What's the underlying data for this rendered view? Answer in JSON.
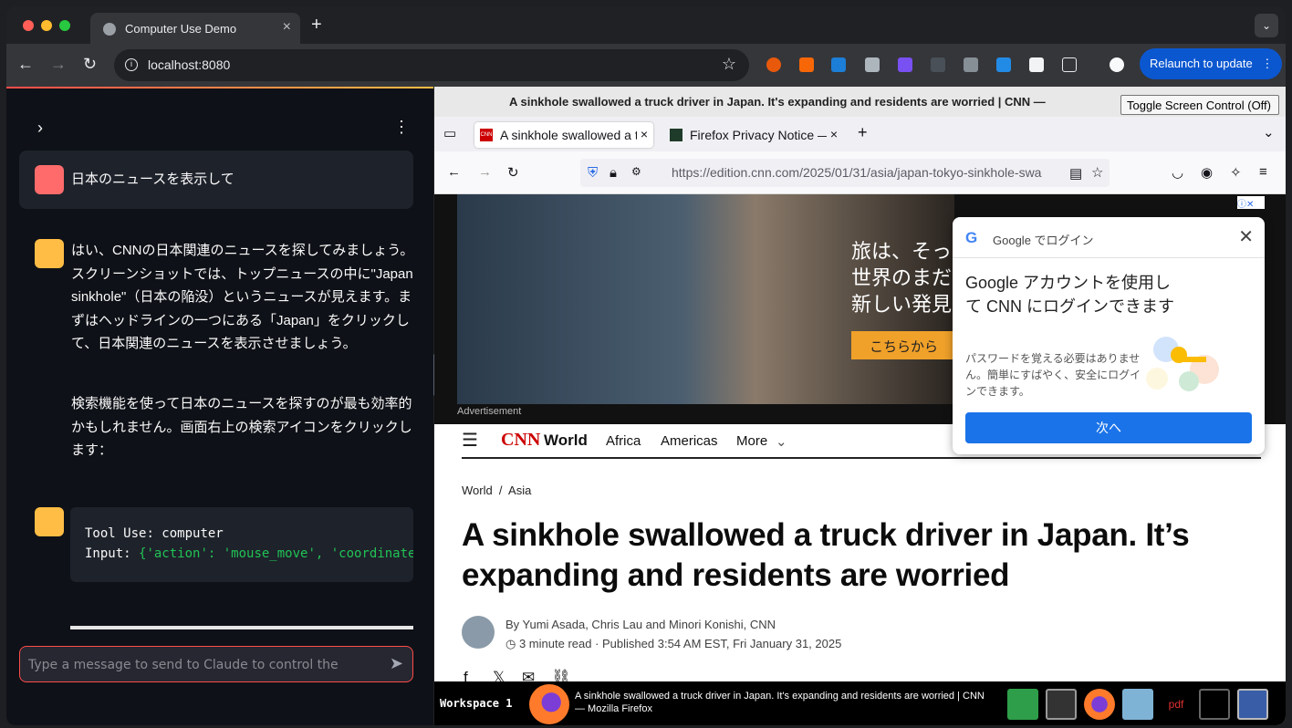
{
  "browser": {
    "tab_title": "Computer Use Demo",
    "url": "localhost:8080",
    "relaunch_label": "Relaunch to update"
  },
  "sidebar": {
    "user_message": "日本のニュースを表示して",
    "assistant_para1": "はい、CNNの日本関連のニュースを探してみましょう。スクリーンショットでは、トップニュースの中に\"Japan sinkhole\"（日本の陥没）というニュースが見えます。まずはヘッドラインの一つにある「Japan」をクリックして、日本関連のニュースを表示させましょう。",
    "assistant_para2": "検索機能を使って日本のニュースを探すのが最も効率的かもしれません。画面右上の検索アイコンをクリックします：",
    "tool_line1_key": "Tool Use",
    "tool_line1_val": "computer",
    "tool_line2_key": "Input",
    "tool_line2_val": "{'action': 'mouse_move', 'coordinate'",
    "input_placeholder": "Type a message to send to Claude to control the"
  },
  "vnc": {
    "window_title": "A sinkhole swallowed a truck driver in Japan. It's expanding and residents are worried | CNN —",
    "toggle_label": "Toggle Screen Control (Off)"
  },
  "firefox": {
    "tabs": [
      {
        "label": "A sinkhole swallowed a tr"
      },
      {
        "label": "Firefox Privacy Notice —"
      }
    ],
    "url": "https://edition.cnn.com/2025/01/31/asia/japan-tokyo-sinkhole-swa"
  },
  "ad": {
    "lines": [
      "旅は、そっと",
      "世界のまだ",
      "新しい発見"
    ],
    "button": "こちらから",
    "label": "Advertisement"
  },
  "google_popup": {
    "header": "Google でログイン",
    "heading": "Google アカウントを使用して CNN にログインできます",
    "description": "パスワードを覚える必要はありません。簡単にすばやく、安全にログインできます。",
    "button": "次へ"
  },
  "cnn": {
    "logo": "CNN",
    "section": "World",
    "nav": [
      "Africa",
      "Americas",
      "More"
    ],
    "breadcrumb": "World  /  Asia",
    "headline": "A sinkhole swallowed a truck driver in Japan. It’s expanding and residents are worried",
    "byline": "By Yumi Asada, Chris Lau and Minori Konishi, CNN",
    "meta": "3 minute read  · Published 3:54 AM EST, Fri January 31, 2025"
  },
  "taskbar": {
    "workspace": "Workspace 1",
    "window_title": "A sinkhole swallowed a truck driver in Japan. It's expanding and residents are worried | CNN — Mozilla Firefox",
    "pdf_label": "pdf"
  },
  "colors": {
    "accent_red": "#ff4b4b",
    "chrome_blue": "#0b57d0",
    "cnn_red": "#cc0000",
    "google_blue": "#1a73e8"
  }
}
